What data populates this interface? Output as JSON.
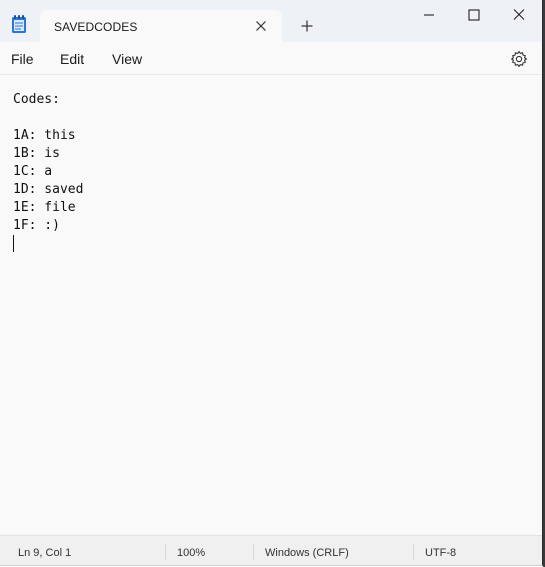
{
  "window": {
    "tab_title": "SAVEDCODES"
  },
  "menu": {
    "file": "File",
    "edit": "Edit",
    "view": "View"
  },
  "editor": {
    "lines": [
      "Codes:",
      "",
      "1A: this",
      "1B: is",
      "1C: a",
      "1D: saved",
      "1E: file",
      "1F: :)"
    ]
  },
  "status": {
    "position": "Ln 9, Col 1",
    "zoom": "100%",
    "line_ending": "Windows (CRLF)",
    "encoding": "UTF-8"
  },
  "icons": {
    "app": "notepad-icon",
    "close_tab": "close-icon",
    "new_tab": "plus-icon",
    "minimize": "minimize-icon",
    "maximize": "maximize-icon",
    "close_window": "close-icon",
    "settings": "gear-icon"
  },
  "colors": {
    "titlebar": "#eef1f6",
    "editor_bg": "#f9f9f9",
    "statusbar": "#f0f0f0",
    "app_icon": "#1e6fc8"
  }
}
